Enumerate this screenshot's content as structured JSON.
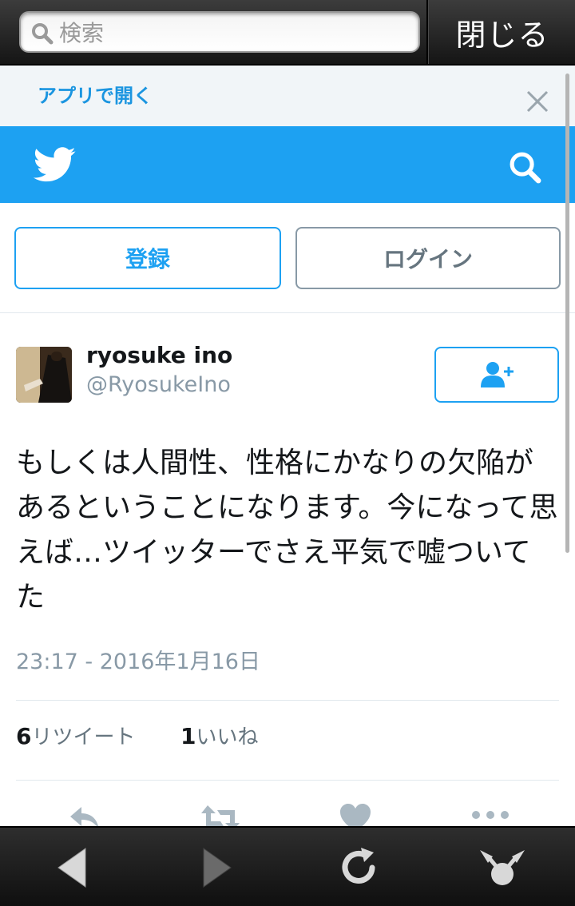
{
  "browser": {
    "search_placeholder": "検索",
    "close_label": "閉じる"
  },
  "banner": {
    "open_in_app": "アプリで開く"
  },
  "auth": {
    "signup_label": "登録",
    "login_label": "ログイン"
  },
  "tweet": {
    "name": "ryosuke ino",
    "handle": "@RyosukeIno",
    "text": "もしくは人間性、性格にかなりの欠陥があるということになります。今になって思えば…ツイッターでさえ平気で嘘ついてた",
    "timestamp": "23:17 - 2016年1月16日",
    "retweet_count": "6",
    "retweet_label": "リツイート",
    "like_count": "1",
    "like_label": "いいね"
  },
  "colors": {
    "twitter_blue": "#1da1f2",
    "link_blue": "#1b95e0",
    "text_dark": "#14171a",
    "text_gray": "#8899a6"
  },
  "icons": [
    "search-icon",
    "close-icon",
    "twitter-bird-icon",
    "follow-user-icon",
    "reply-icon",
    "retweet-icon",
    "like-icon",
    "more-icon",
    "back-icon",
    "forward-icon",
    "reload-icon",
    "share-icon"
  ]
}
